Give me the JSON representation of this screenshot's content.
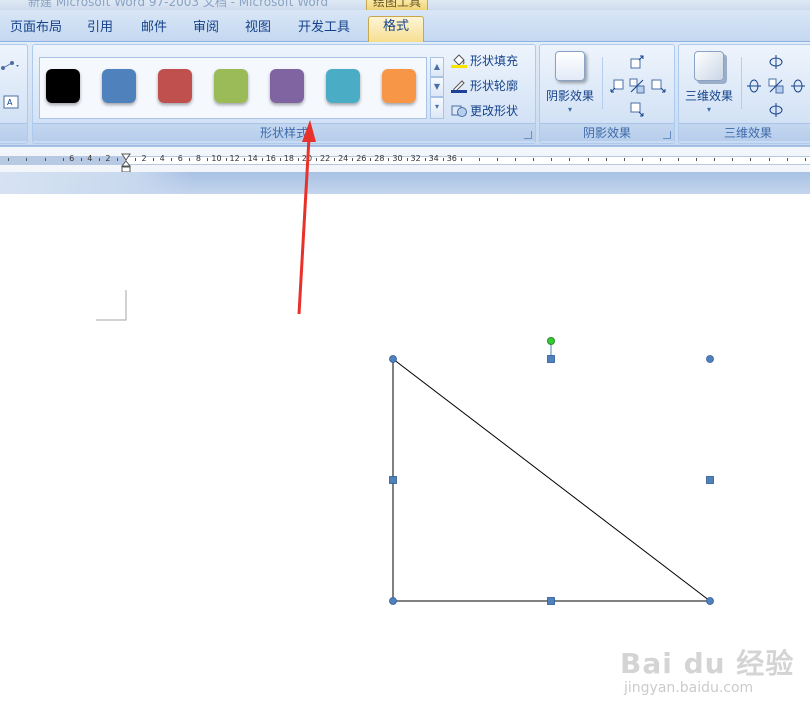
{
  "window": {
    "title": "新建 Microsoft Word 97-2003 文档 - Microsoft Word",
    "context_tab_group": "绘图工具"
  },
  "tabs": [
    {
      "label": "页面布局",
      "active": false
    },
    {
      "label": "引用",
      "active": false
    },
    {
      "label": "邮件",
      "active": false
    },
    {
      "label": "审阅",
      "active": false
    },
    {
      "label": "视图",
      "active": false
    },
    {
      "label": "开发工具",
      "active": false
    },
    {
      "label": "格式",
      "active": true
    }
  ],
  "ribbon": {
    "shape_styles": {
      "group_label": "形状样式",
      "swatches": [
        {
          "name": "black",
          "color": "#000000"
        },
        {
          "name": "blue",
          "color": "#4f81bd"
        },
        {
          "name": "red",
          "color": "#c0504d"
        },
        {
          "name": "green",
          "color": "#9bbb59"
        },
        {
          "name": "purple",
          "color": "#8064a2"
        },
        {
          "name": "aqua",
          "color": "#4bacc6"
        },
        {
          "name": "orange",
          "color": "#f79646"
        }
      ],
      "commands": {
        "fill": "形状填充",
        "outline": "形状轮廓",
        "change": "更改形状"
      }
    },
    "shadow_effects": {
      "group_label": "阴影效果",
      "button_label": "阴影效果"
    },
    "three_d_effects": {
      "group_label": "三维效果",
      "button_label": "三维效果"
    }
  },
  "ruler": {
    "left_labels": [
      "6",
      "4",
      "2"
    ],
    "labels": [
      "2",
      "4",
      "6",
      "8",
      "10",
      "12",
      "14",
      "16",
      "18",
      "20",
      "22",
      "24",
      "26",
      "28",
      "30",
      "32",
      "34",
      "36"
    ]
  },
  "colors": {
    "annotation_arrow": "#e8312a",
    "selection_handle": "#4f81bd",
    "rotation_handle": "#33cc33",
    "shape_outline": "#000000"
  },
  "watermark": {
    "brand": "Bai du 经验",
    "url": "jingyan.baidu.com"
  }
}
